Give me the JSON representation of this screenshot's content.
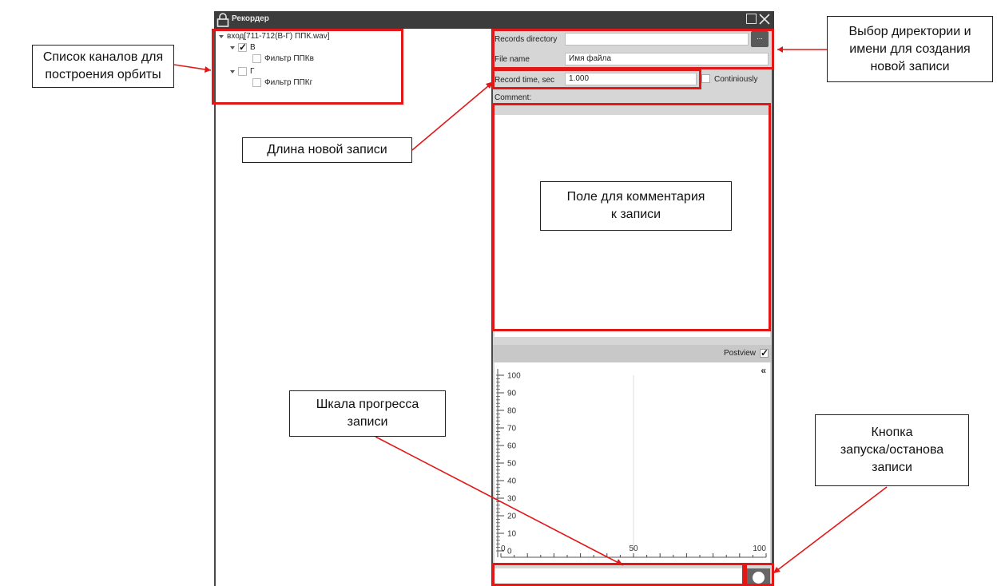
{
  "window": {
    "title": "Рекордер"
  },
  "tree": {
    "root": "вход[711-712(В-Г) ППК.wav]",
    "channels": [
      {
        "label": "В",
        "checked": true,
        "filter": "Фильтр ППКв"
      },
      {
        "label": "Г",
        "checked": false,
        "filter": "Фильтр ППКг"
      }
    ]
  },
  "form": {
    "records_directory_label": "Records directory",
    "records_directory_value": "",
    "browse_label": "...",
    "file_name_label": "File name",
    "file_name_value": "Имя файла",
    "record_time_label": "Record time, sec",
    "record_time_value": "1.000",
    "continuously_label": "Continiously",
    "continuously_checked": false,
    "comment_label": "Comment:"
  },
  "postview": {
    "label": "Postview",
    "checked": true,
    "collapse_glyph": "«"
  },
  "chart_data": {
    "type": "line",
    "y_ticks": [
      "100",
      "90",
      "80",
      "70",
      "60",
      "50",
      "40",
      "30",
      "20",
      "10",
      "0"
    ],
    "x_ticks": [
      "0",
      "50",
      "100"
    ],
    "xlim": [
      0,
      100
    ],
    "ylim": [
      0,
      100
    ],
    "series": []
  },
  "progress": {
    "value": 0
  },
  "callouts": {
    "channels": "Список каналов для\nпостроения орбиты",
    "length": "Длина новой записи",
    "directory": "Выбор директории и\nимени для создания\nновой записи",
    "comment": "Поле для комментария\nк записи",
    "progress": "Шкала прогресса\nзаписи",
    "button": "Кнопка\nзапуска/останова\nзаписи"
  },
  "colors": {
    "highlight": "#e01818",
    "window_dark": "#3c3c3c",
    "panel": "#d6d6d6"
  }
}
